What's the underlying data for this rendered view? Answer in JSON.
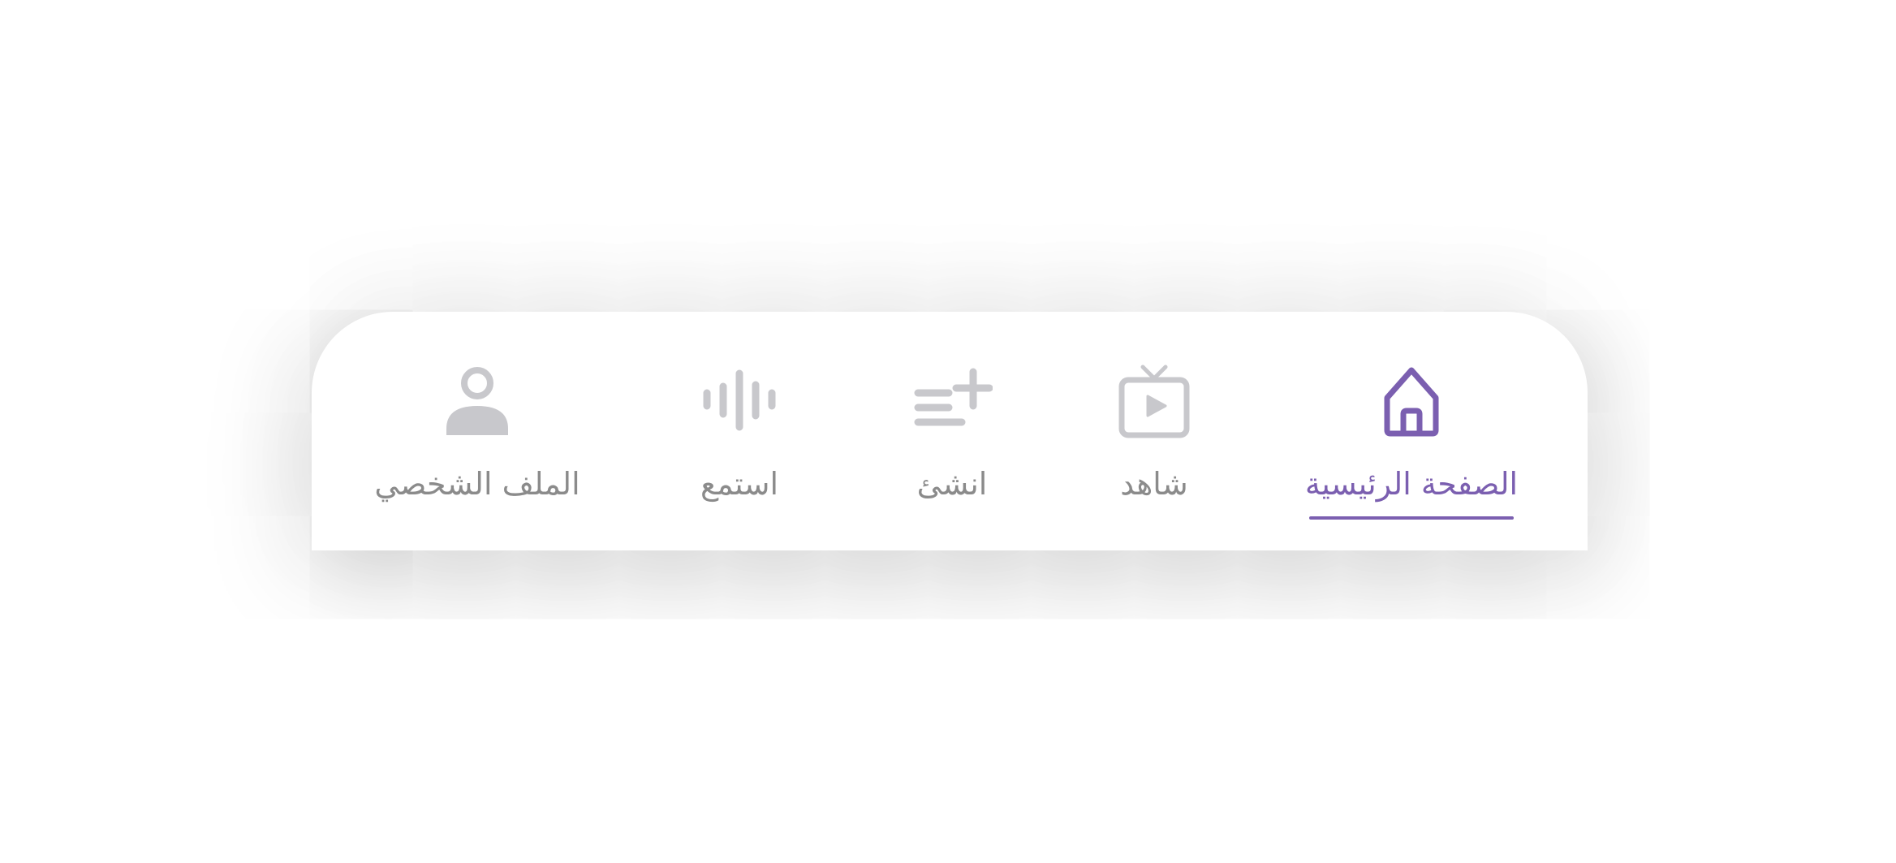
{
  "colors": {
    "active": "#7b5fb0",
    "inactive_icon": "#c8c8cc",
    "inactive_label": "#8b8b8b"
  },
  "tabs": [
    {
      "label": "الصفحة الرئيسية",
      "icon": "home-icon",
      "active": true
    },
    {
      "label": "شاهد",
      "icon": "tv-icon",
      "active": false
    },
    {
      "label": "انشئ",
      "icon": "create-list-icon",
      "active": false
    },
    {
      "label": "استمع",
      "icon": "audio-waveform-icon",
      "active": false
    },
    {
      "label": "الملف الشخصي",
      "icon": "profile-icon",
      "active": false
    }
  ]
}
